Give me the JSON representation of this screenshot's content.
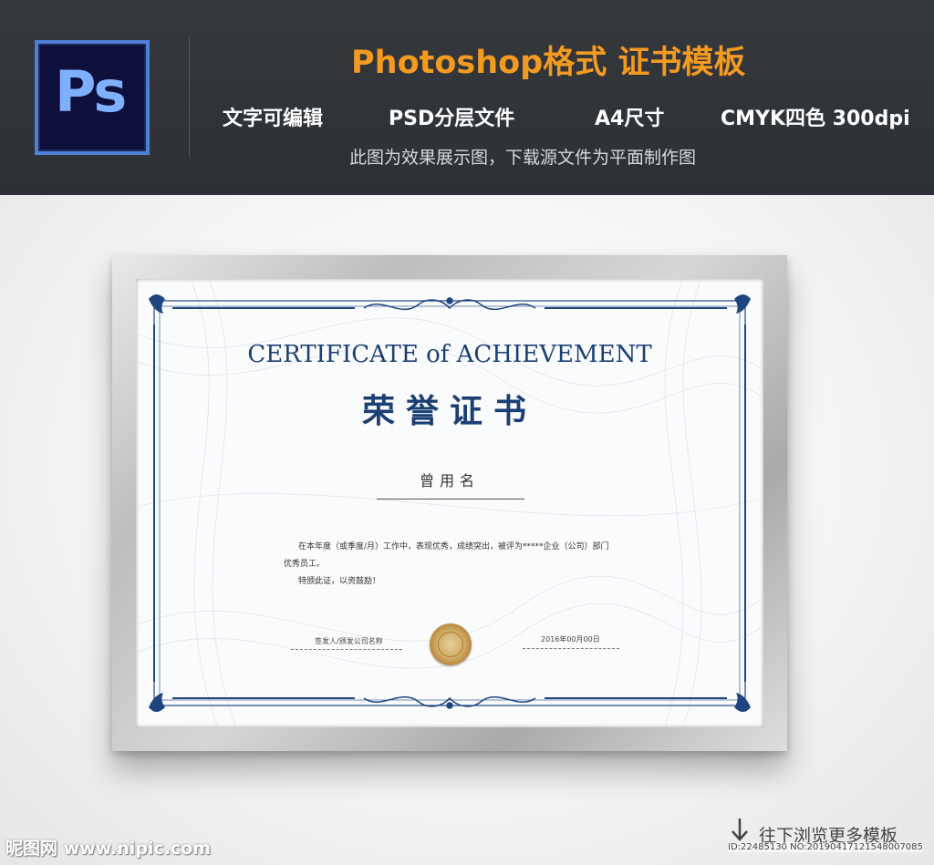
{
  "banner": {
    "logo_text": "Ps",
    "title": "Photoshop格式  证书模板",
    "features": [
      "文字可编辑",
      "PSD分层文件",
      "A4尺寸",
      "CMYK四色 300dpi"
    ],
    "note": "此图为效果展示图，下载源文件为平面制作图"
  },
  "certificate": {
    "title_en": "CERTIFICATE of ACHIEVEMENT",
    "title_cn": "荣誉证书",
    "recipient": "曾用名",
    "body_line1": "在本年度（或季度/月）工作中，表现优秀，成绩突出，被评为*****企业（公司）部门",
    "body_line2": "优秀员工。",
    "body_line3": "特颁此证，以资鼓励！",
    "signer_label": "签发人/颁发公司名称",
    "date_label": "2016年00月00日"
  },
  "footer": {
    "watermark": "昵图网 www.nipic.com",
    "more_label": "往下浏览更多模板",
    "id_text": "ID:22485130 NO:20190417121548007085"
  },
  "colors": {
    "banner_bg": "#2f3237",
    "accent_orange": "#f39a21",
    "certificate_blue": "#1c3f73"
  },
  "icons": [
    "ps-logo-icon",
    "arrow-down-icon"
  ]
}
